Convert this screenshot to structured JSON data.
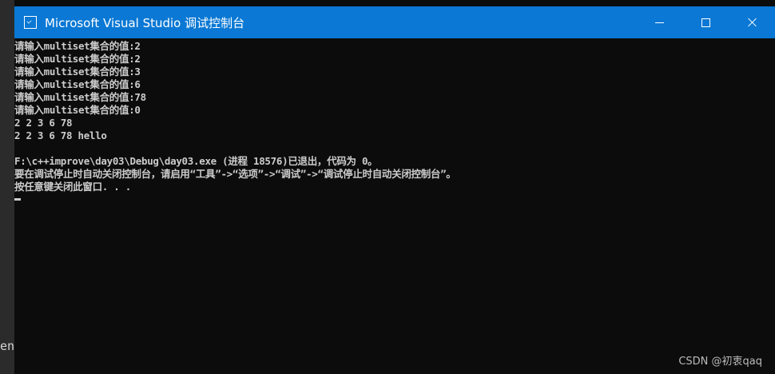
{
  "desktop": {
    "fragment_text": "en"
  },
  "window": {
    "title": "Microsoft Visual Studio 调试控制台",
    "icon": "console-app-icon",
    "controls": {
      "minimize_icon": "minimize-icon",
      "maximize_icon": "maximize-icon",
      "close_icon": "close-icon"
    },
    "title_bar_color": "#0a78d4",
    "background_color": "#0c0c0c",
    "text_color": "#cccccc"
  },
  "console": {
    "lines": [
      "请输入multiset集合的值:2",
      "请输入multiset集合的值:2",
      "请输入multiset集合的值:3",
      "请输入multiset集合的值:6",
      "请输入multiset集合的值:78",
      "请输入multiset集合的值:0",
      "2 2 3 6 78",
      "2 2 3 6 78 hello",
      "",
      "F:\\c++improve\\day03\\Debug\\day03.exe (进程 18576)已退出，代码为 0。",
      "要在调试停止时自动关闭控制台，请启用“工具”->“选项”->“调试”->“调试停止时自动关闭控制台”。",
      "按任意键关闭此窗口. . ."
    ]
  },
  "watermark": {
    "text": "CSDN @初衷qaq"
  }
}
